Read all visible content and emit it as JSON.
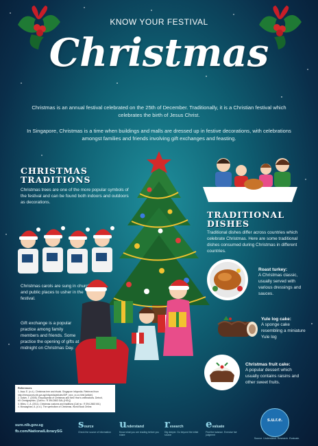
{
  "kicker": "KNOW YOUR FESTIVAL",
  "title": "Christmas",
  "intro": [
    "Christmas is an annual festival celebrated on the 25th of December. Traditionally, it is a Christian festival which celebrates the birth of Jesus Christ.",
    "In Singapore, Christmas is a time when buildings and malls are dressed up in festive decorations, with celebrations amongst families and friends involving gift exchanges and feasting."
  ],
  "traditions": {
    "heading_line1": "CHRISTMAS",
    "heading_line2": "TRADITIONS",
    "tree_text": "Christmas trees are one of the more popular symbols of the festival and can be found both indoors and outdoors as decorations.",
    "carol_text": "Christmas carols are sung in churches and public places to usher in the festival.",
    "gift_text": "Gift exchange is a popular practice among family members and friends. Some practice the opening of gifts at midnight on Christmas Day."
  },
  "dishes": {
    "heading_line1": "TRADITIONAL",
    "heading_line2": "DISHES",
    "intro": "Traditional dishes differ across countries which celebrate Christmas. Here are some traditional dishes consumed during Christmas in different countries.",
    "items": [
      {
        "name": "Roast turkey:",
        "desc": "A Christmas classic, usually served with various dressings and sauces."
      },
      {
        "name": "Yule log cake:",
        "desc": "A sponge cake resembling a miniature Yule log"
      },
      {
        "name": "Christmas fruit cake:",
        "desc": "A popular dessert which usually contains raisins and other sweet fruits."
      }
    ]
  },
  "references": {
    "heading": "References",
    "lines": [
      "1. Aww, E. (n.d.). Christmas tree and rituals. Singapore Infopedia. Retrieved from",
      "http://eresources.nlb.gov.sg/infopedia/articles/SIP_xxxx_xx-xx.html [article].",
      "2. Galvin, T. (2005). Encyclopedia of Christmas and New Year's celebrations. Detroit,",
      "MI: Omnigraphics. (Call no.: R 394.2663 GAL-[HOL])",
      "3. Miles, C. A. (2011). Christmas customs and traditions (Call no.: R 394.2663 MIL)",
      "4. Mossaghian, A. (n.d.). The symbolism of Christmas. World Book Online."
    ]
  },
  "footer": {
    "links": [
      "sure.nlb.gov.sg",
      "fb.com/NationalLibrarySG"
    ],
    "pillars": [
      {
        "letter": "s",
        "title": "ource",
        "sub": "Check the source of information"
      },
      {
        "letter": "u",
        "title": "nderstand",
        "sub": "Know what you are reading before you share"
      },
      {
        "letter": "r",
        "title": "esearch",
        "sub": "Dig deeper. Go beyond the initial source"
      },
      {
        "letter": "e",
        "title": "valuate",
        "sub": "Find the balance. Exercise fair judgment"
      }
    ],
    "badge": "s.u.r.e.",
    "badge_sub": "Source. Understand. Research. Evaluate."
  },
  "colors": {
    "bg_center": "#1f8f9c",
    "bg_edge": "#071a33",
    "santa_red": "#d42a2a",
    "tree_green": "#1f6b2e",
    "gold": "#f2c230"
  }
}
